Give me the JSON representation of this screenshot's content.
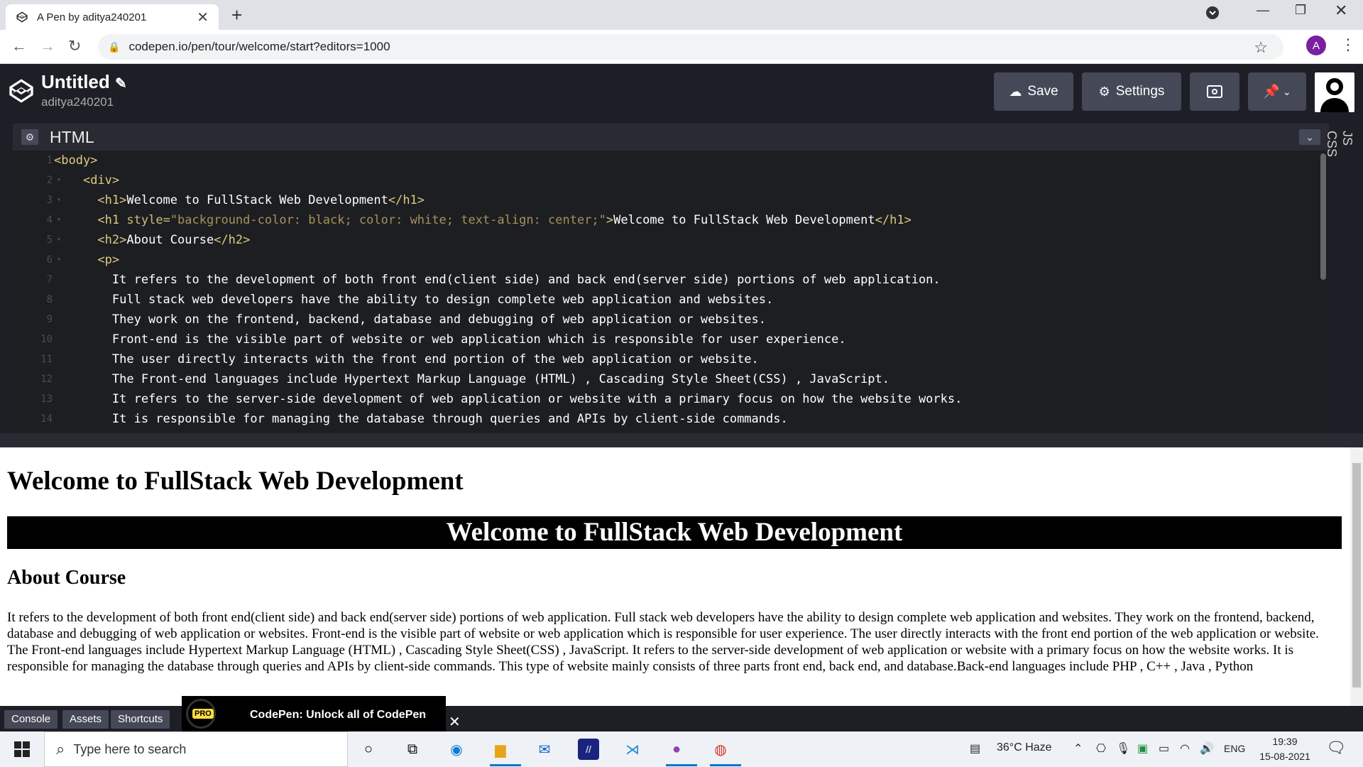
{
  "browser": {
    "tab_title": "A Pen by aditya240201",
    "tab_close": "✕",
    "new_tab": "+",
    "url": "codepen.io/pen/tour/welcome/start?editors=1000",
    "profile_initial": "A"
  },
  "codepen": {
    "pen_title": "Untitled",
    "edit_icon": "✎",
    "username": "aditya240201",
    "save_label": "Save",
    "settings_label": "Settings",
    "editor_title": "HTML",
    "side_tabs": [
      "CSS",
      "JS"
    ]
  },
  "code_lines": [
    {
      "n": "1",
      "fold": "▾",
      "html": "<span class='tag'>&lt;body&gt;</span>"
    },
    {
      "n": "2",
      "fold": "▾",
      "html": "    <span class='tag'>&lt;div&gt;</span>"
    },
    {
      "n": "3",
      "fold": "▾",
      "html": "      <span class='tag'>&lt;h1&gt;</span>Welcome to FullStack Web Development<span class='tag'>&lt;/h1&gt;</span>"
    },
    {
      "n": "4",
      "fold": "▾",
      "html": "      <span class='tag'>&lt;h1</span> <span class='attr'>style=</span><span class='str'>\"background-color: black; color: white; text-align: center;\"</span><span class='tag'>&gt;</span>Welcome to FullStack Web Development<span class='tag'>&lt;/h1&gt;</span>"
    },
    {
      "n": "5",
      "fold": "▾",
      "html": "      <span class='tag'>&lt;h2&gt;</span>About Course<span class='tag'>&lt;/h2&gt;</span>"
    },
    {
      "n": "6",
      "fold": "▾",
      "html": "      <span class='tag'>&lt;p&gt;</span>"
    },
    {
      "n": "7",
      "fold": "",
      "html": "        It refers to the development of both front end(client side) and back end(server side) portions of web application."
    },
    {
      "n": "8",
      "fold": "",
      "html": "        Full stack web developers have the ability to design complete web application and websites."
    },
    {
      "n": "9",
      "fold": "",
      "html": "        They work on the frontend, backend, database and debugging of web application or websites."
    },
    {
      "n": "10",
      "fold": "",
      "html": "        Front-end is the visible part of website or web application which is responsible for user experience."
    },
    {
      "n": "11",
      "fold": "",
      "html": "        The user directly interacts with the front end portion of the web application or website."
    },
    {
      "n": "12",
      "fold": "",
      "html": "        The Front-end languages include Hypertext Markup Language (HTML) , Cascading Style Sheet(CSS) , JavaScript."
    },
    {
      "n": "13",
      "fold": "",
      "html": "        It refers to the server-side development of web application or website with a primary focus on how the website works."
    },
    {
      "n": "14",
      "fold": "",
      "html": "        It is responsible for managing the database through queries and APIs by client-side commands."
    }
  ],
  "preview": {
    "h1": "Welcome to FullStack Web Development",
    "h1_styled": "Welcome to FullStack Web Development",
    "h2": "About Course",
    "paragraph": "It refers to the development of both front end(client side) and back end(server side) portions of web application. Full stack web developers have the ability to design complete web application and websites. They work on the frontend, backend, database and debugging of web application or websites. Front-end is the visible part of website or web application which is responsible for user experience. The user directly interacts with the front end portion of the web application or website. The Front-end languages include Hypertext Markup Language (HTML) , Cascading Style Sheet(CSS) , JavaScript. It refers to the server-side development of web application or website with a primary focus on how the website works. It is responsible for managing the database through queries and APIs by client-side commands. This type of website mainly consists of three parts front end, back end, and database.Back-end languages include PHP , C++ , Java , Python"
  },
  "bottombar": {
    "console": "Console",
    "assets": "Assets",
    "shortcuts": "Shortcuts",
    "pro_badge": "PRO",
    "promo_text": "CodePen: Unlock all of CodePen",
    "promo_close": "✕"
  },
  "taskbar": {
    "search_placeholder": "Type here to search",
    "weather": "36°C  Haze",
    "lang": "ENG",
    "time": "19:39",
    "date": "15-08-2021"
  },
  "colors": {
    "codepen_bg": "#1e1f26",
    "button_bg": "#444857",
    "tag": "#ddca7e",
    "string": "#a7925a"
  }
}
